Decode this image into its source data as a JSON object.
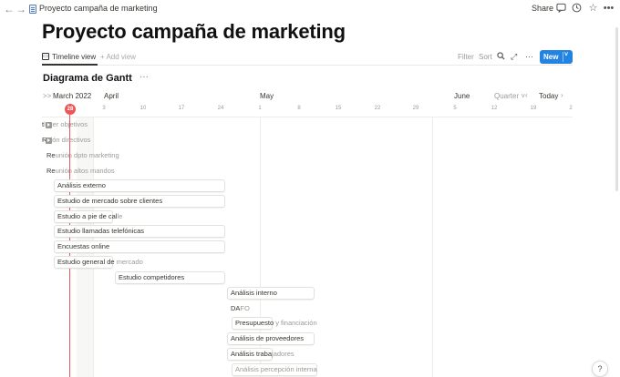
{
  "breadcrumb": {
    "page_title": "Proyecto campaña de marketing"
  },
  "topbar": {
    "share_label": "Share"
  },
  "icons": {
    "back": "arrow-left-icon",
    "forward": "arrow-right-icon",
    "page": "page-icon",
    "comments": "comment-icon",
    "updates": "clock-icon",
    "favorite": "star-icon",
    "more": "more-icon"
  },
  "page": {
    "title": "Proyecto campaña de marketing"
  },
  "viewbar": {
    "tab_label": "Timeline view",
    "add_view_label": "+ Add view",
    "filter_label": "Filter",
    "sort_label": "Sort",
    "new_label": "New"
  },
  "section": {
    "title": "Diagrama de Gantt",
    "more": "···"
  },
  "timeline": {
    "collapse_label": ">>",
    "months": [
      "March 2022",
      "April",
      "May",
      "June"
    ],
    "ticks": [
      "3",
      "10",
      "17",
      "24",
      "1",
      "8",
      "15",
      "22",
      "29",
      "5",
      "12",
      "19",
      "2"
    ],
    "scale_label": "Quarter",
    "scale_caret": "˅",
    "today_label": "Today",
    "prev": "‹",
    "next": "›",
    "today_date": "28"
  },
  "tasks": [
    {
      "lead": "",
      "rest": "Establecer objetivos",
      "display_prefix": "t",
      "display_rest": "lecer objetivos"
    },
    {
      "lead": "",
      "rest": "Reunión directivos",
      "display_prefix": "R",
      "display_rest": "nión directivos"
    },
    {
      "lead": "Re",
      "rest": "unión dpto marketing"
    },
    {
      "lead": "Re",
      "rest": "unión altos mandos"
    },
    {
      "lead": "Análisis externo",
      "rest": ""
    },
    {
      "lead": "Estudio de mercado sobre clientes",
      "rest": ""
    },
    {
      "lead": "Estudio a pie de cal",
      "rest": "le"
    },
    {
      "lead": "Estudio llamadas telefónicas",
      "rest": ""
    },
    {
      "lead": "Encuestas online",
      "rest": ""
    },
    {
      "lead": "Estudio general de ",
      "rest": "mercado"
    },
    {
      "lead": "Estudio competidores",
      "rest": ""
    },
    {
      "lead": "Análisis interno",
      "rest": ""
    },
    {
      "lead": "DA",
      "rest": "FO"
    },
    {
      "lead": "Presupuesto",
      "rest": " y financiación"
    },
    {
      "lead": "Análisis de proveedores",
      "rest": ""
    },
    {
      "lead": "Análisis traba",
      "rest": "jadores"
    },
    {
      "lead": "",
      "rest": "Análisis percepción interna"
    }
  ],
  "help_label": "?"
}
